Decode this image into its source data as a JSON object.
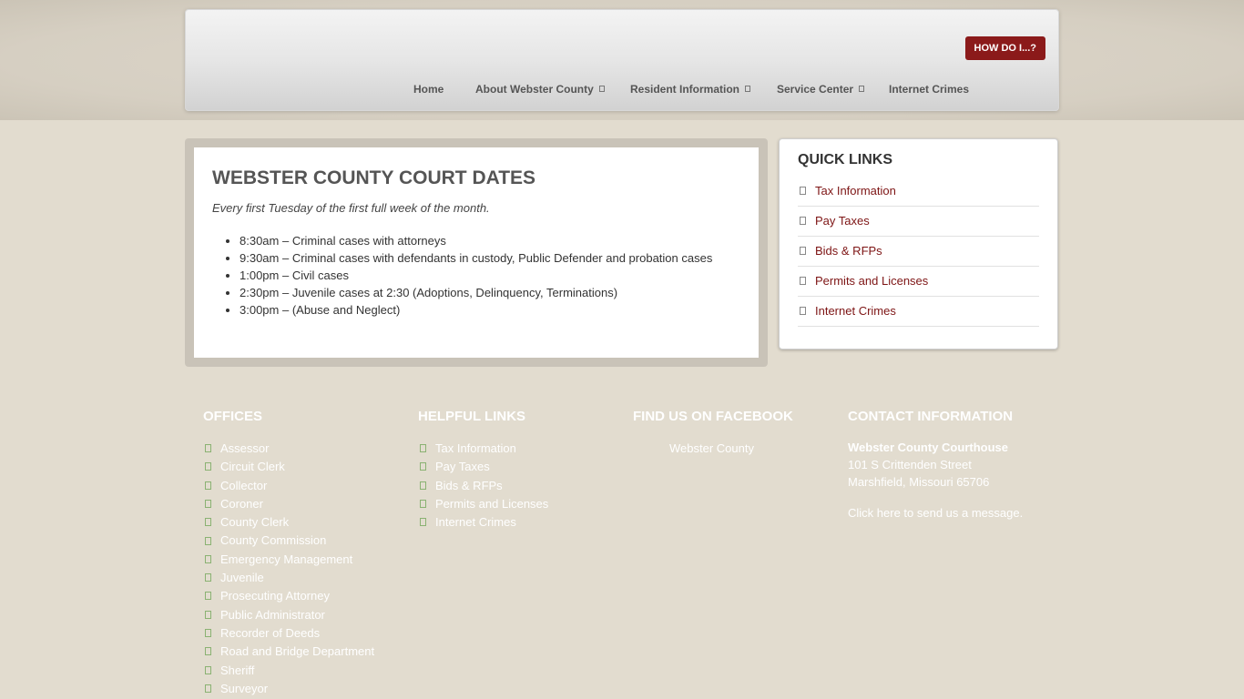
{
  "header": {
    "how_do_i": "HOW DO I...?",
    "nav": [
      {
        "label": "Home"
      },
      {
        "label": "About Webster County"
      },
      {
        "label": "Resident Information"
      },
      {
        "label": "Service Center"
      },
      {
        "label": "Internet Crimes"
      }
    ]
  },
  "main": {
    "title": "WEBSTER COUNTY COURT DATES",
    "intro": "Every first Tuesday of the first full week of the month.",
    "schedule": [
      "8:30am – Criminal cases with attorneys",
      "9:30am – Criminal cases with defendants in custody, Public Defender and probation cases",
      "1:00pm – Civil cases",
      "2:30pm – Juvenile cases at 2:30 (Adoptions, Delinquency, Terminations)",
      "3:00pm – (Abuse and Neglect)"
    ]
  },
  "quick_links": {
    "title": "QUICK LINKS",
    "items": [
      "Tax Information",
      "Pay Taxes",
      "Bids & RFPs",
      "Permits and Licenses",
      "Internet Crimes"
    ]
  },
  "footer": {
    "offices": {
      "title": "OFFICES",
      "items": [
        "Assessor",
        "Circuit Clerk",
        "Collector",
        "Coroner",
        "County Clerk",
        "County Commission",
        "Emergency Management",
        "Juvenile",
        "Prosecuting Attorney",
        "Public Administrator",
        "Recorder of Deeds",
        "Road and Bridge Department",
        "Sheriff",
        "Surveyor"
      ]
    },
    "helpful": {
      "title": "HELPFUL LINKS",
      "items": [
        "Tax Information",
        "Pay Taxes",
        "Bids & RFPs",
        "Permits and Licenses",
        "Internet Crimes"
      ]
    },
    "facebook": {
      "title": "FIND US ON FACEBOOK",
      "link": "Webster County"
    },
    "contact": {
      "title": "CONTACT INFORMATION",
      "name": "Webster County Courthouse",
      "street": "101 S Crittenden Street",
      "city": "Marshfield, Missouri 65706",
      "message": "Click here to send us a message."
    }
  },
  "colors": {
    "accent": "#8b1a1a",
    "link": "#7d1414",
    "background": "#e2dccf"
  }
}
